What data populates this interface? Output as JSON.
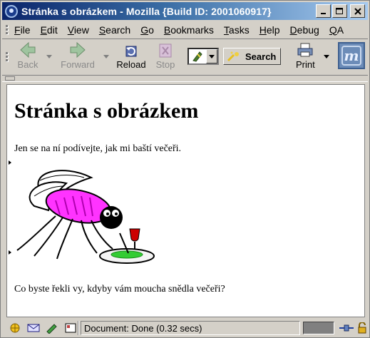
{
  "window": {
    "title": "Stránka s obrázkem - Mozilla {Build ID: 2001060917}",
    "controls": {
      "minimize": "_",
      "maximize": "□",
      "close": "✕"
    }
  },
  "menubar": {
    "items": [
      {
        "label": "File",
        "underline": "F"
      },
      {
        "label": "Edit",
        "underline": "E"
      },
      {
        "label": "View",
        "underline": "V"
      },
      {
        "label": "Search",
        "underline": "S"
      },
      {
        "label": "Go",
        "underline": "G"
      },
      {
        "label": "Bookmarks",
        "underline": "B"
      },
      {
        "label": "Tasks",
        "underline": "T"
      },
      {
        "label": "Help",
        "underline": "H"
      },
      {
        "label": "Debug",
        "underline": "D"
      },
      {
        "label": "QA",
        "underline": "Q"
      }
    ]
  },
  "toolbar": {
    "back_label": "Back",
    "forward_label": "Forward",
    "reload_label": "Reload",
    "stop_label": "Stop",
    "search_label": "Search",
    "print_label": "Print"
  },
  "page": {
    "heading": "Stránka s obrázkem",
    "intro": "Jen se na ní podívejte, jak mi baští večeři.",
    "question": "Co byste řekli vy, kdyby vám moucha snědla večeři?"
  },
  "statusbar": {
    "text": "Document: Done (0.32 secs)"
  },
  "colors": {
    "titlebar_start": "#0a246a",
    "titlebar_end": "#a6caf0",
    "chrome": "#d4d0c8",
    "fly_body": "#ff33ff",
    "salad": "#33cc33",
    "wine": "#cc0000"
  }
}
